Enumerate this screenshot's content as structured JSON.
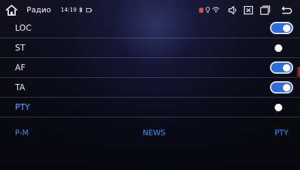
{
  "status_bar": {
    "app_title": "Радио",
    "time": "14:19",
    "icons": [
      "home-icon",
      "bluetooth-icon",
      "battery-icon",
      "sd-card-icon",
      "location-icon",
      "wifi-icon",
      "volume-icon",
      "close-window-icon",
      "recent-apps-icon",
      "back-icon"
    ]
  },
  "settings": {
    "rows": [
      {
        "label": "LOC",
        "on": true
      },
      {
        "label": "ST",
        "on": false
      },
      {
        "label": "AF",
        "on": true
      },
      {
        "label": "TA",
        "on": true
      },
      {
        "label": "PTY",
        "on": false
      }
    ]
  },
  "bottom_bar": {
    "left": "P-M",
    "center": "NEWS",
    "right": "PTY"
  },
  "colors": {
    "accent_blue": "#3f91ff",
    "toggle_on": "#2f6bd8",
    "pty_label": "#5aa8ff"
  }
}
